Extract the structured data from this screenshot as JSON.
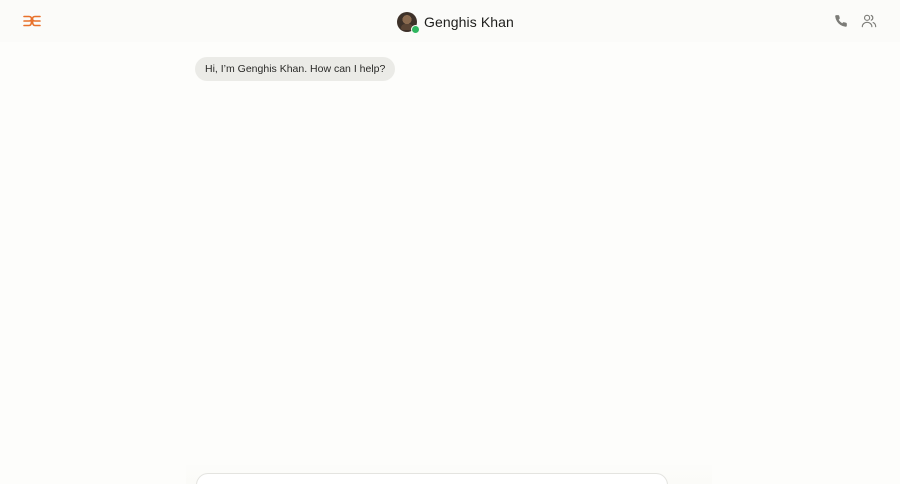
{
  "header": {
    "logo_icon": "logo-icon",
    "chat_name": "Genghis Khan",
    "avatar_icon": "avatar-image",
    "status": "online",
    "status_color": "#2fb65f",
    "call_icon": "phone-icon",
    "participants_icon": "people-icon",
    "accent_color": "#e8712b"
  },
  "messages": [
    {
      "sender": "Genghis Khan",
      "text": "Hi, I’m Genghis Khan. How can I help?"
    }
  ],
  "composer": {
    "placeholder": ""
  }
}
